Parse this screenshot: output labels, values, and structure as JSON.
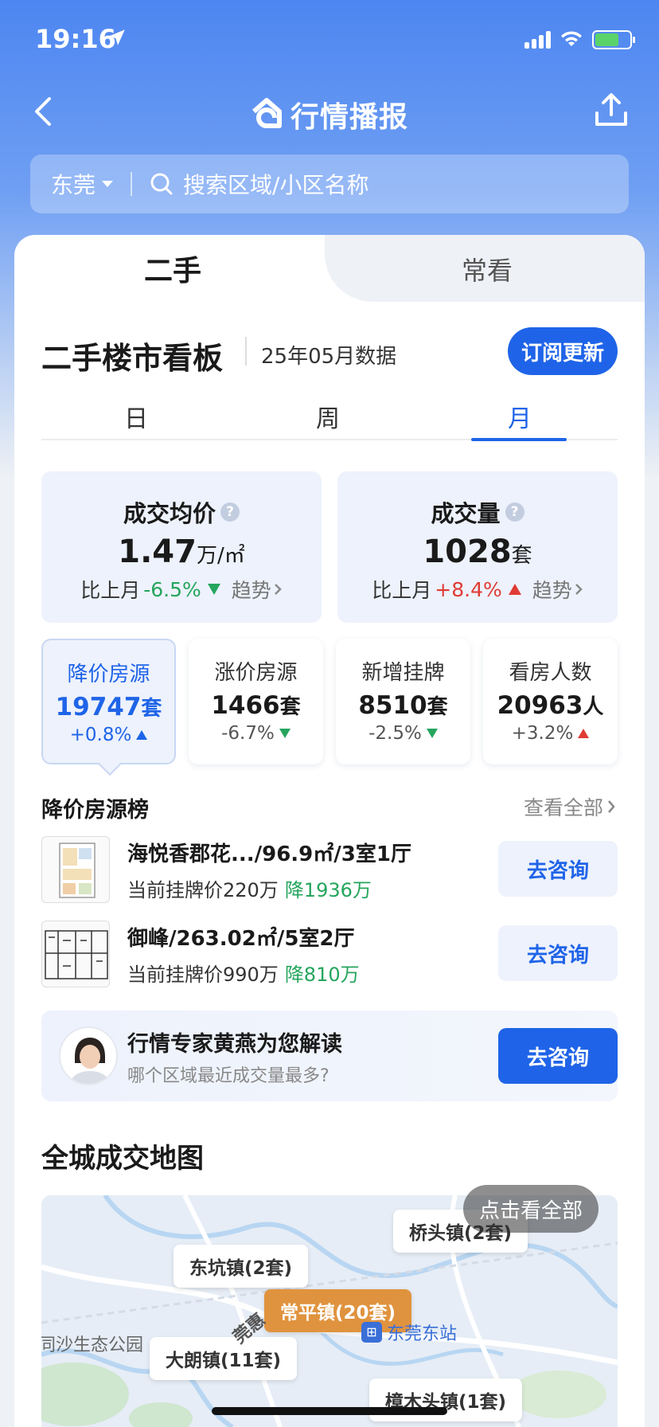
{
  "status": {
    "time": "19:16"
  },
  "nav": {
    "title": "行情播报"
  },
  "search": {
    "city": "东莞",
    "placeholder": "搜索区域/小区名称"
  },
  "tabs": {
    "active": "二手",
    "other": "常看"
  },
  "board": {
    "title": "二手楼市看板",
    "date": "25年05月数据",
    "subscribe": "订阅更新"
  },
  "period_tabs": [
    "日",
    "周",
    "月"
  ],
  "stats": [
    {
      "title": "成交均价",
      "value": "1.47",
      "unit": "万/㎡",
      "compare_label": "比上月",
      "change": "-6.5%",
      "direction": "down",
      "trend": "趋势"
    },
    {
      "title": "成交量",
      "value": "1028",
      "unit": "套",
      "compare_label": "比上月",
      "change": "+8.4%",
      "direction": "up",
      "trend": "趋势"
    }
  ],
  "mini_stats": [
    {
      "title": "降价房源",
      "value": "19747",
      "unit": "套",
      "change": "+0.8%",
      "direction": "up"
    },
    {
      "title": "涨价房源",
      "value": "1466",
      "unit": "套",
      "change": "-6.7%",
      "direction": "down"
    },
    {
      "title": "新增挂牌",
      "value": "8510",
      "unit": "套",
      "change": "-2.5%",
      "direction": "down"
    },
    {
      "title": "看房人数",
      "value": "20963",
      "unit": "人",
      "change": "+3.2%",
      "direction": "up"
    }
  ],
  "price_drop_list": {
    "title": "降价房源榜",
    "see_all": "查看全部",
    "items": [
      {
        "title": "海悦香郡花.../96.9㎡/3室1厅",
        "price_label": "当前挂牌价220万",
        "drop": "降1936万",
        "button": "去咨询"
      },
      {
        "title": "御峰/263.02㎡/5室2厅",
        "price_label": "当前挂牌价990万",
        "drop": "降810万",
        "button": "去咨询"
      }
    ]
  },
  "expert": {
    "name": "行情专家黄燕为您解读",
    "question": "哪个区域最近成交量最多?",
    "button": "去咨询"
  },
  "map": {
    "title": "全城成交地图",
    "labels": [
      {
        "text": "桥头镇(2套)",
        "hot": false
      },
      {
        "text": "东坑镇(2套)",
        "hot": false
      },
      {
        "text": "常平镇(20套)",
        "hot": true
      },
      {
        "text": "大朗镇(11套)",
        "hot": false
      },
      {
        "text": "樟木头镇(1套)",
        "hot": false
      }
    ],
    "place_text": "同沙生态公园",
    "road_text": "莞惠",
    "station": "东莞东站",
    "view_all": "点击看全部"
  },
  "colors": {
    "accent": "#1f64e8",
    "up": "#e03b35",
    "down": "#25a55d",
    "hot": "#e0933e"
  }
}
